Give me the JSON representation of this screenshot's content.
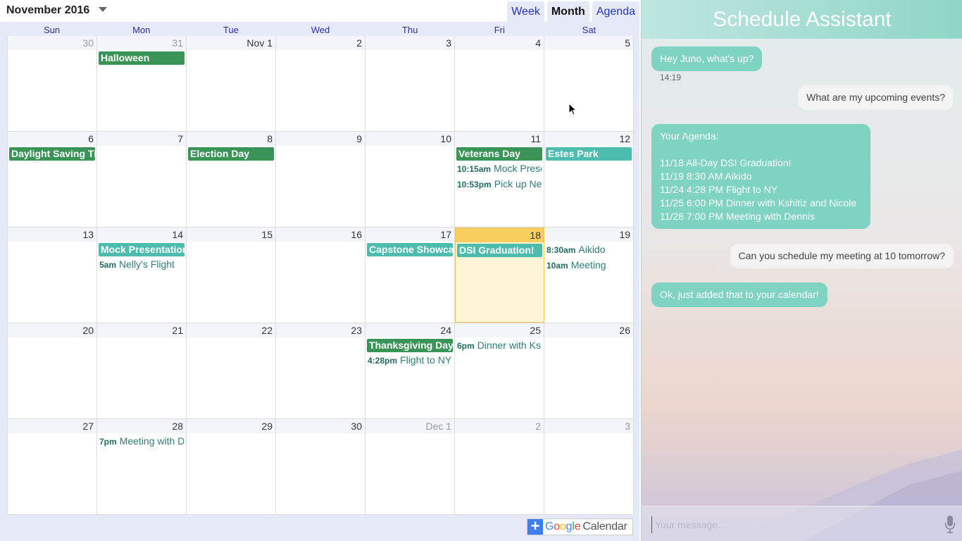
{
  "calendar": {
    "month_title": "November 2016",
    "tabs": [
      {
        "label": "Week",
        "active": false
      },
      {
        "label": "Month",
        "active": true
      },
      {
        "label": "Agenda",
        "active": false
      }
    ],
    "weekdays": [
      "Sun",
      "Mon",
      "Tue",
      "Wed",
      "Thu",
      "Fri",
      "Sat"
    ],
    "weeks": [
      [
        {
          "label": "30",
          "off": true,
          "events": []
        },
        {
          "label": "31",
          "off": true,
          "events": [
            {
              "kind": "chip",
              "color": "green",
              "text": "Halloween"
            }
          ]
        },
        {
          "label": "Nov 1",
          "events": []
        },
        {
          "label": "2",
          "events": []
        },
        {
          "label": "3",
          "events": []
        },
        {
          "label": "4",
          "events": []
        },
        {
          "label": "5",
          "events": []
        }
      ],
      [
        {
          "label": "6",
          "events": [
            {
              "kind": "chip",
              "color": "green",
              "text": "Daylight Saving Time ends"
            }
          ]
        },
        {
          "label": "7",
          "events": []
        },
        {
          "label": "8",
          "events": [
            {
              "kind": "chip",
              "color": "green",
              "text": "Election Day"
            }
          ]
        },
        {
          "label": "9",
          "events": []
        },
        {
          "label": "10",
          "events": []
        },
        {
          "label": "11",
          "events": [
            {
              "kind": "chip",
              "color": "green",
              "text": "Veterans Day"
            },
            {
              "kind": "timed",
              "time": "10:15am",
              "text": "Mock Presentation"
            },
            {
              "kind": "timed",
              "time": "10:53pm",
              "text": "Pick up Nelly"
            }
          ]
        },
        {
          "label": "12",
          "events": [
            {
              "kind": "chip",
              "color": "teal",
              "text": "Estes Park"
            }
          ]
        }
      ],
      [
        {
          "label": "13",
          "events": []
        },
        {
          "label": "14",
          "events": [
            {
              "kind": "chip",
              "color": "teal",
              "text": "Mock Presentation"
            },
            {
              "kind": "timed",
              "time": "5am",
              "text": "Nelly's Flight"
            }
          ]
        },
        {
          "label": "15",
          "events": []
        },
        {
          "label": "16",
          "events": []
        },
        {
          "label": "17",
          "events": [
            {
              "kind": "chip",
              "color": "teal",
              "text": "Capstone Showcase"
            }
          ]
        },
        {
          "label": "18",
          "today": true,
          "events": [
            {
              "kind": "chip",
              "color": "teal",
              "text": "DSI Graduation!"
            }
          ]
        },
        {
          "label": "19",
          "events": [
            {
              "kind": "timed",
              "time": "8:30am",
              "text": "Aikido"
            },
            {
              "kind": "timed",
              "time": "10am",
              "text": "Meeting"
            }
          ]
        }
      ],
      [
        {
          "label": "20",
          "events": []
        },
        {
          "label": "21",
          "events": []
        },
        {
          "label": "22",
          "events": []
        },
        {
          "label": "23",
          "events": []
        },
        {
          "label": "24",
          "events": [
            {
              "kind": "chip",
              "color": "green",
              "text": "Thanksgiving Day"
            },
            {
              "kind": "timed",
              "time": "4:28pm",
              "text": "Flight to NY"
            }
          ]
        },
        {
          "label": "25",
          "events": [
            {
              "kind": "timed",
              "time": "6pm",
              "text": "Dinner with Kshitiz and Nicole"
            }
          ]
        },
        {
          "label": "26",
          "events": []
        }
      ],
      [
        {
          "label": "27",
          "events": []
        },
        {
          "label": "28",
          "events": [
            {
              "kind": "timed",
              "time": "7pm",
              "text": "Meeting with Dennis"
            }
          ]
        },
        {
          "label": "29",
          "events": []
        },
        {
          "label": "30",
          "events": []
        },
        {
          "label": "Dec 1",
          "off": true,
          "events": []
        },
        {
          "label": "2",
          "off": true,
          "events": []
        },
        {
          "label": "3",
          "off": true,
          "events": []
        }
      ]
    ],
    "google_calendar_button": {
      "google": [
        "G",
        "o",
        "o",
        "g",
        "l",
        "e"
      ],
      "calendar": "Calendar"
    },
    "colors": {
      "green": "#3a9457",
      "teal": "#4cbcae",
      "today": "#f8cf5e"
    }
  },
  "assistant": {
    "title": "Schedule Assistant",
    "messages": [
      {
        "from": "bot",
        "text": "Hey Juno, what's up?"
      },
      {
        "from": "timestamp",
        "text": "14:19"
      },
      {
        "from": "user",
        "text": "What are my upcoming events?"
      },
      {
        "from": "bot",
        "lines": [
          "Your Agenda:",
          "",
          "11/18 All-Day DSI Graduation!",
          "11/19 8:30 AM Aikido",
          "11/24 4:28 PM Flight to NY",
          "11/25 6:00 PM Dinner with Kshitiz and Nicole",
          "11/28 7:00 PM Meeting with Dennis"
        ]
      },
      {
        "from": "user",
        "text": "Can you schedule my meeting at 10 tomorrow?"
      },
      {
        "from": "bot",
        "text": "Ok, just added that to your calendar!"
      }
    ],
    "input_placeholder": "Your message...",
    "mic_icon": "microphone-icon",
    "accent": "#7ed3c1"
  }
}
